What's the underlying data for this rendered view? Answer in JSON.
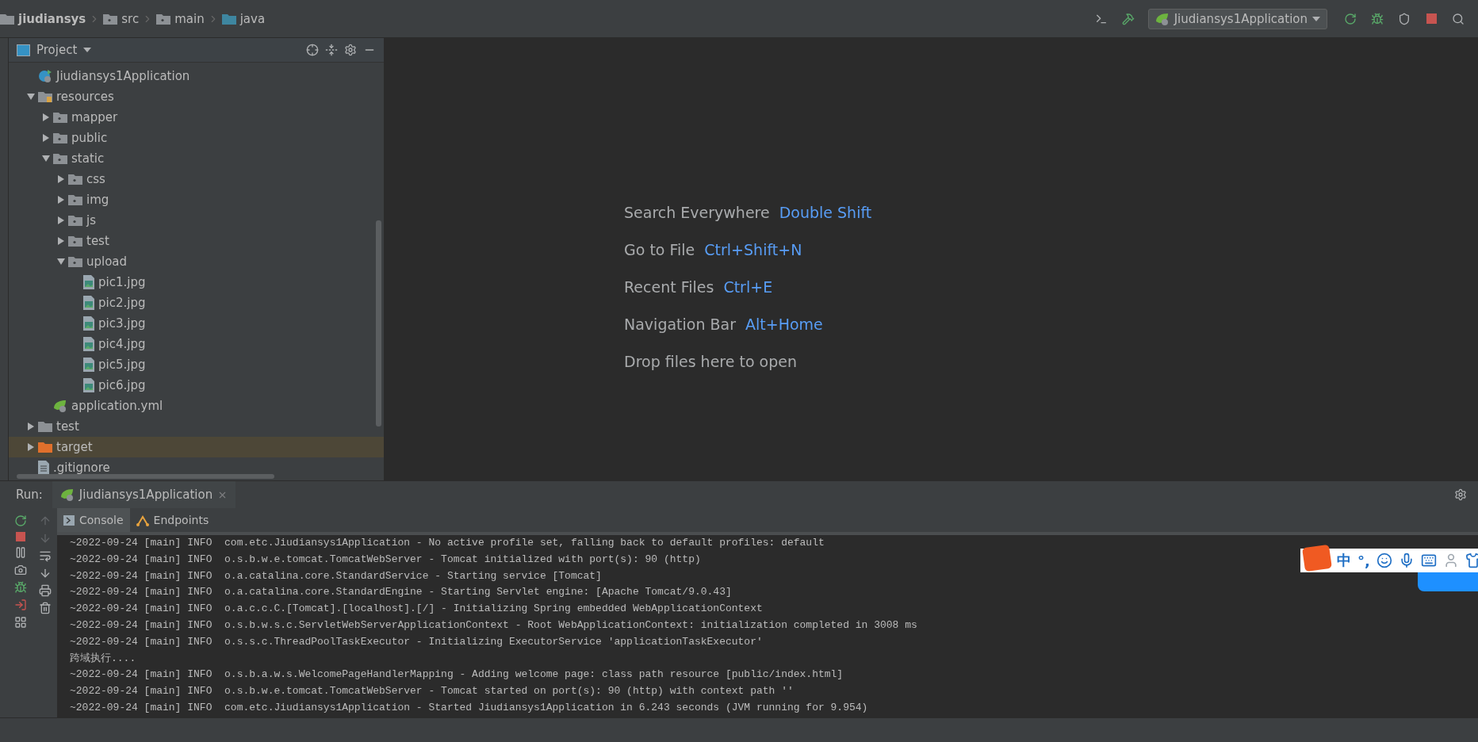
{
  "breadcrumb": [
    {
      "label": "jiudiansys",
      "kind": "project"
    },
    {
      "label": "src",
      "kind": "folder"
    },
    {
      "label": "main",
      "kind": "folder"
    },
    {
      "label": "java",
      "kind": "source"
    }
  ],
  "run_config": {
    "label": "Jiudiansys1Application"
  },
  "project_panel": {
    "title": "Project",
    "tree": [
      {
        "label": "Jiudiansys1Application",
        "kind": "spring-class",
        "highlighted": false
      },
      {
        "label": "resources",
        "kind": "resource-folder",
        "expanded": true,
        "highlighted": false,
        "children": [
          {
            "label": "mapper",
            "kind": "folder",
            "expanded": false
          },
          {
            "label": "public",
            "kind": "folder",
            "expanded": false
          },
          {
            "label": "static",
            "kind": "folder",
            "expanded": true,
            "children": [
              {
                "label": "css",
                "kind": "folder",
                "expanded": false
              },
              {
                "label": "img",
                "kind": "folder",
                "expanded": false
              },
              {
                "label": "js",
                "kind": "folder",
                "expanded": false
              },
              {
                "label": "test",
                "kind": "folder",
                "expanded": false
              },
              {
                "label": "upload",
                "kind": "folder",
                "expanded": true,
                "children": [
                  {
                    "label": "pic1.jpg",
                    "kind": "image"
                  },
                  {
                    "label": "pic2.jpg",
                    "kind": "image"
                  },
                  {
                    "label": "pic3.jpg",
                    "kind": "image"
                  },
                  {
                    "label": "pic4.jpg",
                    "kind": "image"
                  },
                  {
                    "label": "pic5.jpg",
                    "kind": "image"
                  },
                  {
                    "label": "pic6.jpg",
                    "kind": "image"
                  }
                ]
              }
            ]
          },
          {
            "label": "application.yml",
            "kind": "spring-config"
          }
        ]
      },
      {
        "label": "test",
        "kind": "plain-folder",
        "expanded": false,
        "highlighted": false
      },
      {
        "label": "target",
        "kind": "excluded-folder",
        "expanded": false,
        "highlighted": true
      },
      {
        "label": ".gitignore",
        "kind": "file",
        "highlighted": false
      }
    ]
  },
  "editor_hints": [
    {
      "action": "Search Everywhere",
      "shortcut": "Double Shift"
    },
    {
      "action": "Go to File",
      "shortcut": "Ctrl+Shift+N"
    },
    {
      "action": "Recent Files",
      "shortcut": "Ctrl+E"
    },
    {
      "action": "Navigation Bar",
      "shortcut": "Alt+Home"
    },
    {
      "action": "Drop files here to open"
    }
  ],
  "run_panel": {
    "label": "Run:",
    "tab": "Jiudiansys1Application",
    "tabs": [
      {
        "label": "Console",
        "kind": "console",
        "selected": true
      },
      {
        "label": "Endpoints",
        "kind": "endpoints",
        "selected": false
      }
    ],
    "console_lines": [
      "~2022-09-24 [main] INFO  com.etc.Jiudiansys1Application - No active profile set, falling back to default profiles: default",
      "~2022-09-24 [main] INFO  o.s.b.w.e.tomcat.TomcatWebServer - Tomcat initialized with port(s): 90 (http)",
      "~2022-09-24 [main] INFO  o.a.catalina.core.StandardService - Starting service [Tomcat]",
      "~2022-09-24 [main] INFO  o.a.catalina.core.StandardEngine - Starting Servlet engine: [Apache Tomcat/9.0.43]",
      "~2022-09-24 [main] INFO  o.a.c.c.C.[Tomcat].[localhost].[/] - Initializing Spring embedded WebApplicationContext",
      "~2022-09-24 [main] INFO  o.s.b.w.s.c.ServletWebServerApplicationContext - Root WebApplicationContext: initialization completed in 3008 ms",
      "~2022-09-24 [main] INFO  o.s.s.c.ThreadPoolTaskExecutor - Initializing ExecutorService 'applicationTaskExecutor'",
      "跨域执行....",
      "~2022-09-24 [main] INFO  o.s.b.a.w.s.WelcomePageHandlerMapping - Adding welcome page: class path resource [public/index.html]",
      "~2022-09-24 [main] INFO  o.s.b.w.e.tomcat.TomcatWebServer - Tomcat started on port(s): 90 (http) with context path ''",
      "~2022-09-24 [main] INFO  com.etc.Jiudiansys1Application - Started Jiudiansys1Application in 6.243 seconds (JVM running for 9.954)"
    ]
  },
  "ime_toolbar": {
    "mode": "中",
    "punctuation": "°,"
  }
}
